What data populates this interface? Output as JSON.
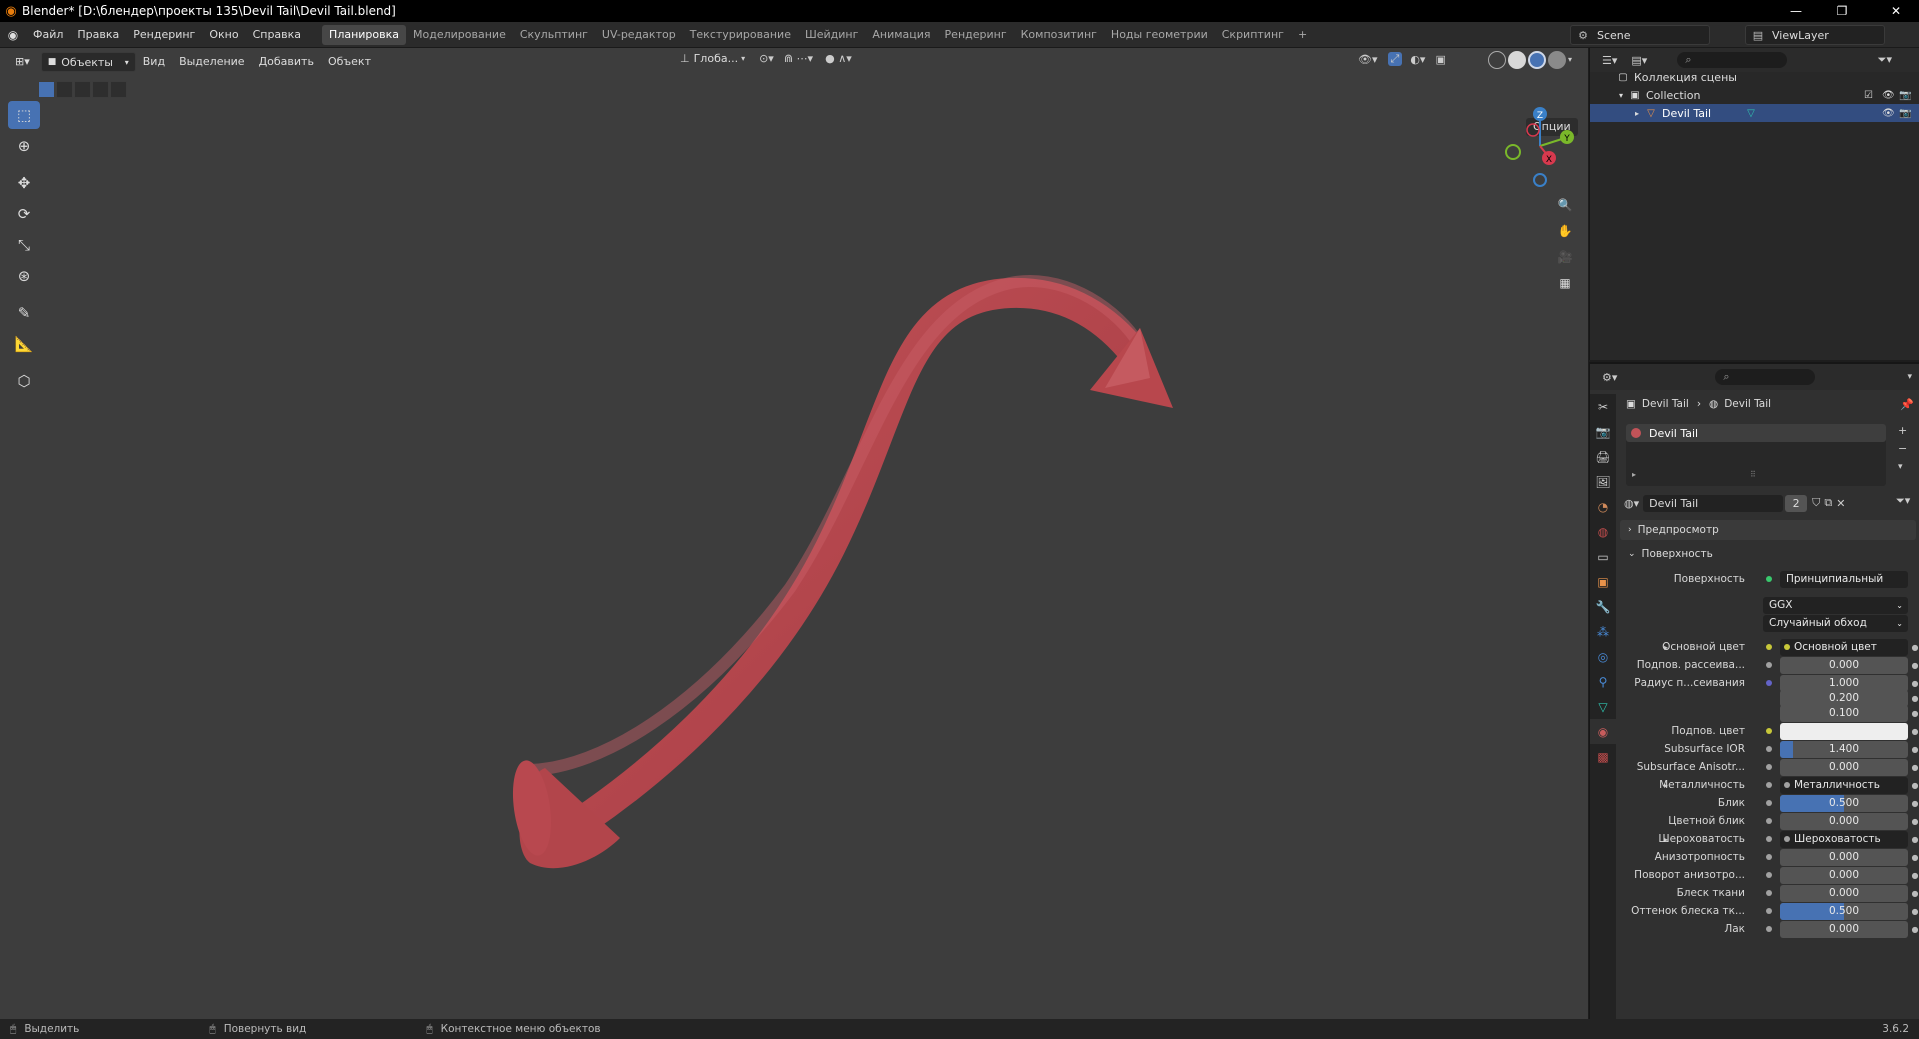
{
  "titlebar": {
    "title": "Blender* [D:\\блендер\\проекты 135\\Devil Tail\\Devil Tail.blend]",
    "minimize": "—",
    "maximize": "❐",
    "close": "✕"
  },
  "menu": {
    "items": [
      "Файл",
      "Правка",
      "Рендеринг",
      "Окно",
      "Справка"
    ],
    "workspaces": [
      "Планировка",
      "Моделирование",
      "Скульптинг",
      "UV-редактор",
      "Текстурирование",
      "Шейдинг",
      "Анимация",
      "Рендеринг",
      "Композитинг",
      "Ноды геометрии",
      "Скриптинг"
    ],
    "active_workspace": "Планировка",
    "add_workspace": "+",
    "scene": "Scene",
    "view_layer": "ViewLayer"
  },
  "viewport": {
    "mode": "Объекты",
    "menus": [
      "Вид",
      "Выделение",
      "Добавить",
      "Объект"
    ],
    "orientation": "Глоба...",
    "options": "Опции",
    "gizmo_axes": {
      "z": "Z",
      "y": "Y",
      "x": "X"
    },
    "object_color": "#b8474d",
    "background_color": "#3d3d3d"
  },
  "outliner": {
    "root": "Коллекция сцены",
    "collection": "Collection",
    "object": "Devil Tail"
  },
  "properties": {
    "breadcrumb_object": "Devil Tail",
    "breadcrumb_material": "Devil Tail",
    "material_slot": "Devil Tail",
    "material_name": "Devil Tail",
    "user_count": "2",
    "panels": {
      "preview": "Предпросмотр",
      "surface": "Поверхность"
    },
    "surface": {
      "label": "Поверхность",
      "shader": "Принципиальный BSDF",
      "distribution": "GGX",
      "subsurface_method": "Случайный обход",
      "rows": [
        {
          "label": "Основной цвет",
          "value": "Основной цвет",
          "kind": "link",
          "dot": "#c7c739",
          "expand": true
        },
        {
          "label": "Подпов. рассеива...",
          "value": "0.000",
          "kind": "num",
          "dot": "#a1a1a1"
        },
        {
          "label": "Радиус п...сеивания",
          "value": "1.000",
          "kind": "num",
          "dot": "#6363c7"
        },
        {
          "label": "",
          "value": "0.200",
          "kind": "num"
        },
        {
          "label": "",
          "value": "0.100",
          "kind": "num"
        },
        {
          "label": "Подпов. цвет",
          "value": "",
          "kind": "color",
          "dot": "#c7c739",
          "color": "#eeeeee"
        },
        {
          "label": "Subsurface IOR",
          "value": "1.400",
          "kind": "num",
          "dot": "#a1a1a1",
          "fill": 0.1
        },
        {
          "label": "Subsurface Anisotr...",
          "value": "0.000",
          "kind": "num",
          "dot": "#a1a1a1"
        },
        {
          "label": "Металличность",
          "value": "Металличность",
          "kind": "link",
          "dot": "#a1a1a1",
          "expand": true
        },
        {
          "label": "Блик",
          "value": "0.500",
          "kind": "num",
          "dot": "#a1a1a1",
          "fill": 0.5
        },
        {
          "label": "Цветной блик",
          "value": "0.000",
          "kind": "num",
          "dot": "#a1a1a1"
        },
        {
          "label": "Шероховатость",
          "value": "Шероховатость",
          "kind": "link",
          "dot": "#a1a1a1",
          "expand": true
        },
        {
          "label": "Анизотропность",
          "value": "0.000",
          "kind": "num",
          "dot": "#a1a1a1"
        },
        {
          "label": "Поворот анизотро...",
          "value": "0.000",
          "kind": "num",
          "dot": "#a1a1a1"
        },
        {
          "label": "Блеск ткани",
          "value": "0.000",
          "kind": "num",
          "dot": "#a1a1a1"
        },
        {
          "label": "Оттенок блеска тк...",
          "value": "0.500",
          "kind": "num",
          "dot": "#a1a1a1",
          "fill": 0.5
        },
        {
          "label": "Лак",
          "value": "0.000",
          "kind": "num",
          "dot": "#a1a1a1"
        }
      ]
    }
  },
  "statusbar": {
    "select": "Выделить",
    "rotate": "Повернуть вид",
    "context": "Контекстное меню объектов",
    "version": "3.6.2"
  }
}
